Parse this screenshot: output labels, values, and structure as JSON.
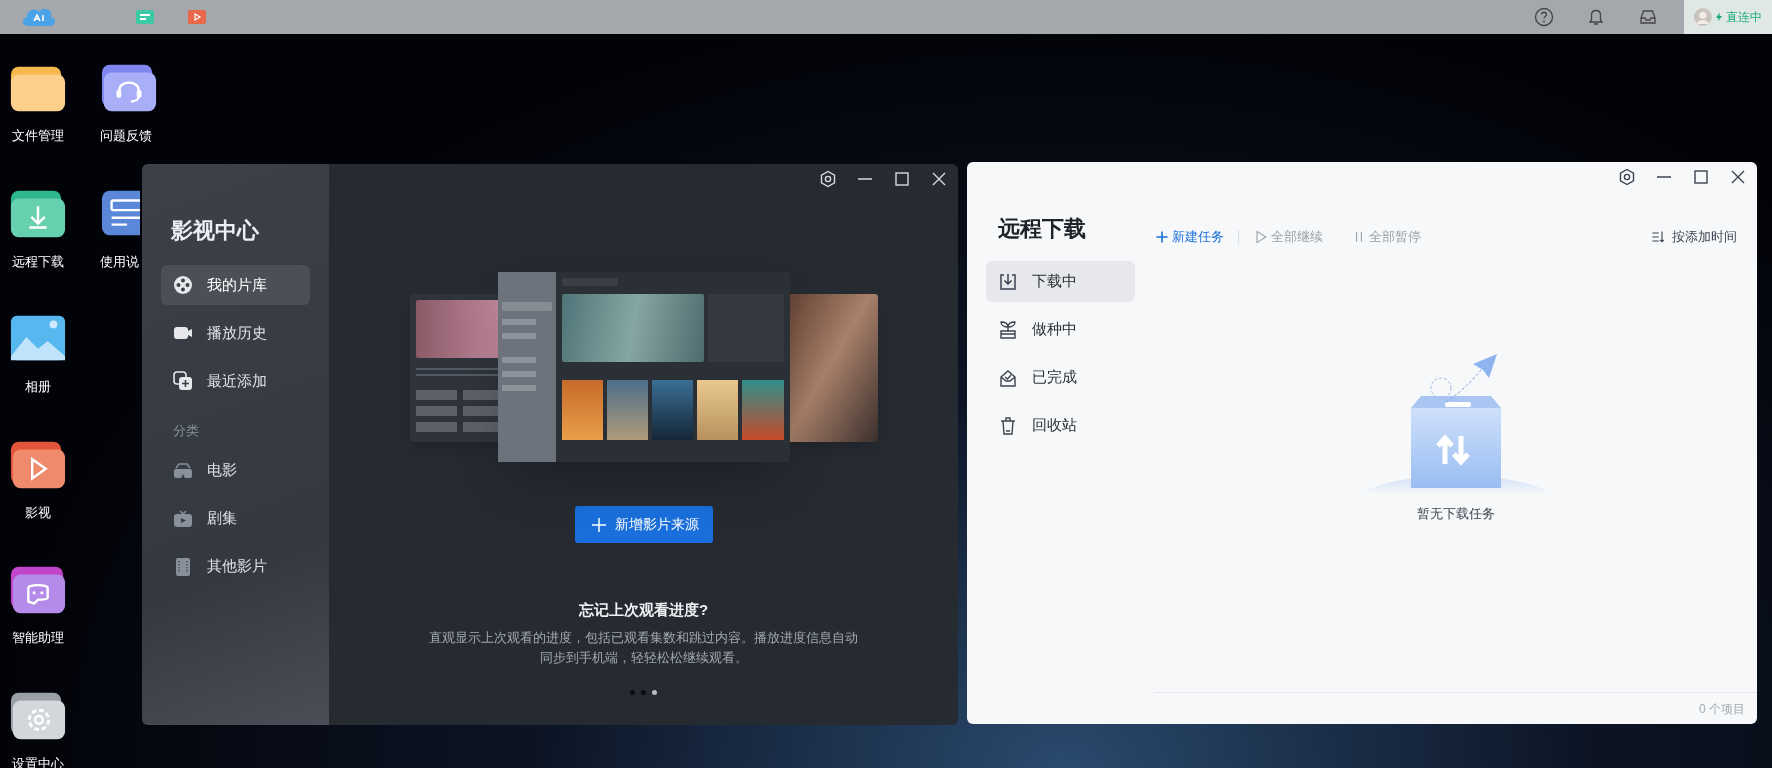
{
  "top_bar": {
    "connection": "直连中"
  },
  "desktop_icons": [
    {
      "label": "文件管理",
      "kind": "folder"
    },
    {
      "label": "问题反馈",
      "kind": "support"
    },
    {
      "label": "远程下载",
      "kind": "download"
    },
    {
      "label": "使用说",
      "kind": "manual"
    },
    {
      "label": "相册",
      "kind": "photos"
    },
    {
      "label": "影视",
      "kind": "video"
    },
    {
      "label": "智能助理",
      "kind": "assistant"
    },
    {
      "label": "设置中心",
      "kind": "settings"
    }
  ],
  "media_window": {
    "title": "影视中心",
    "nav": [
      {
        "label": "我的片库",
        "kind": "library",
        "selected": true
      },
      {
        "label": "播放历史",
        "kind": "history",
        "selected": false
      },
      {
        "label": "最近添加",
        "kind": "recent",
        "selected": false
      }
    ],
    "category_heading": "分类",
    "categories": [
      {
        "label": "电影",
        "kind": "movie"
      },
      {
        "label": "剧集",
        "kind": "series"
      },
      {
        "label": "其他影片",
        "kind": "other"
      }
    ],
    "add_button": "新增影片来源",
    "tip_title": "忘记上次观看进度?",
    "tip_text": "直观显示上次观看的进度，包括已观看集数和跳过内容。播放进度信息自动同步到手机端，轻轻松松继续观看。",
    "pager": [
      {
        "selected": false
      },
      {
        "selected": false
      },
      {
        "selected": true
      }
    ]
  },
  "download_window": {
    "title": "远程下载",
    "nav": [
      {
        "label": "下载中",
        "kind": "downloading",
        "selected": true
      },
      {
        "label": "做种中",
        "kind": "seeding",
        "selected": false
      },
      {
        "label": "已完成",
        "kind": "done",
        "selected": false
      },
      {
        "label": "回收站",
        "kind": "trash",
        "selected": false
      }
    ],
    "actions": [
      {
        "label": "新建任务",
        "kind": "add",
        "disabled": false
      },
      {
        "label": "全部继续",
        "kind": "resume",
        "disabled": true
      },
      {
        "label": "全部暂停",
        "kind": "pause",
        "disabled": true
      }
    ],
    "sort": "按添加时间",
    "empty_message": "暂无下载任务",
    "item_count": "0 个项目"
  }
}
